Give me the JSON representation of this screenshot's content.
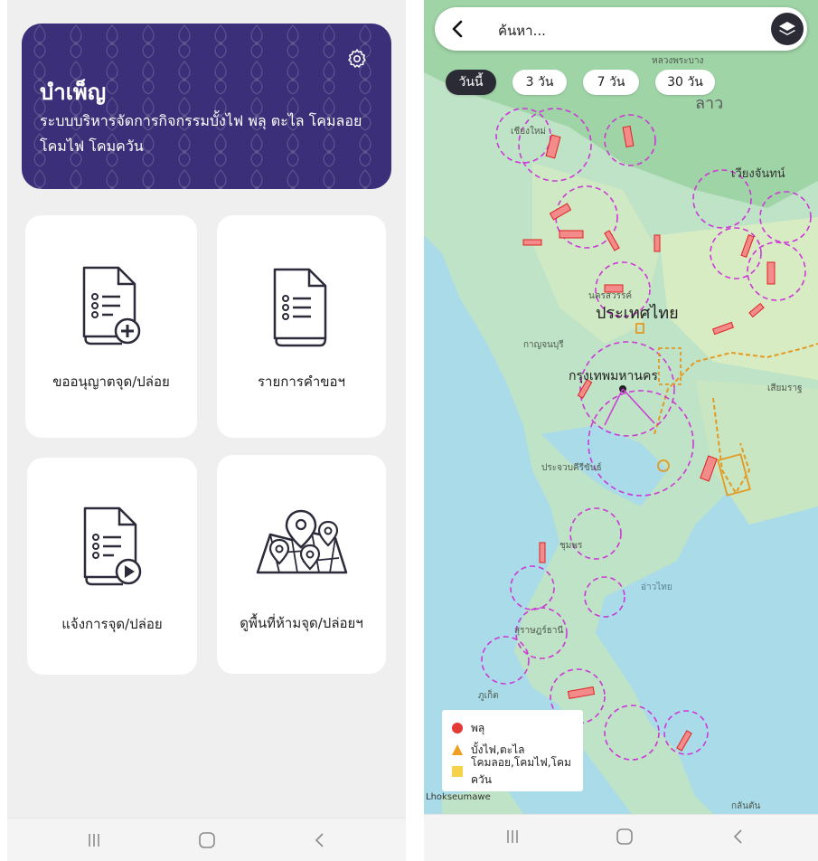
{
  "left_screen": {
    "header": {
      "title": "บำเพ็ญ",
      "subtitle": "ระบบบริหารจัดการกิจกรรมบั้งไฟ พลุ ตะไล โคมลอย โคมไฟ โคมควัน"
    },
    "cards": [
      {
        "label": "ขออนุญาตจุด/ปล่อย",
        "icon": "document-add-icon"
      },
      {
        "label": "รายการคำขอฯ",
        "icon": "document-list-icon"
      },
      {
        "label": "แจ้งการจุด/ปล่อย",
        "icon": "document-play-icon"
      },
      {
        "label": "ดูพื้นที่ห้ามจุด/ปล่อยฯ",
        "icon": "map-pins-icon"
      }
    ]
  },
  "right_screen": {
    "search": {
      "placeholder": "ค้นหา..."
    },
    "filters": [
      {
        "label": "วันนี้",
        "active": true
      },
      {
        "label": "3 วัน",
        "active": false
      },
      {
        "label": "7 วัน",
        "active": false
      },
      {
        "label": "30 วัน",
        "active": false
      }
    ],
    "legend": [
      {
        "label": "พลุ",
        "shape": "circle",
        "color": "#e53935"
      },
      {
        "label": "บั้งไฟ,ตะไล",
        "shape": "triangle",
        "color": "#f0a020"
      },
      {
        "label": "โคมลอย,โคมไฟ,โคมควัน",
        "shape": "square",
        "color": "#f6d24a"
      }
    ],
    "map_labels": {
      "luang_prabang": "หลวงพระบาง",
      "laos": "ลาว",
      "chiang_mai": "เชียงใหม่",
      "vientiane": "เวียงจันทน์",
      "thailand": "ประเทศไทย",
      "bangkok": "กรุงเทพมหานคร",
      "kanchanaburi": "กาญจนบุรี",
      "nakhon_sawan": "นครสวรรค์",
      "cambodia": "เสียมราฐ",
      "chumphon": "ชุมพร",
      "gulf": "อ่าวไทย",
      "surat": "สุราษฎร์ธานี",
      "phuket": "ภูเก็ต",
      "lhokseumawe": "Lhokseumawe",
      "kelantan": "กลันตัน",
      "prachuap": "ประจวบคีรีขันธ์"
    }
  }
}
